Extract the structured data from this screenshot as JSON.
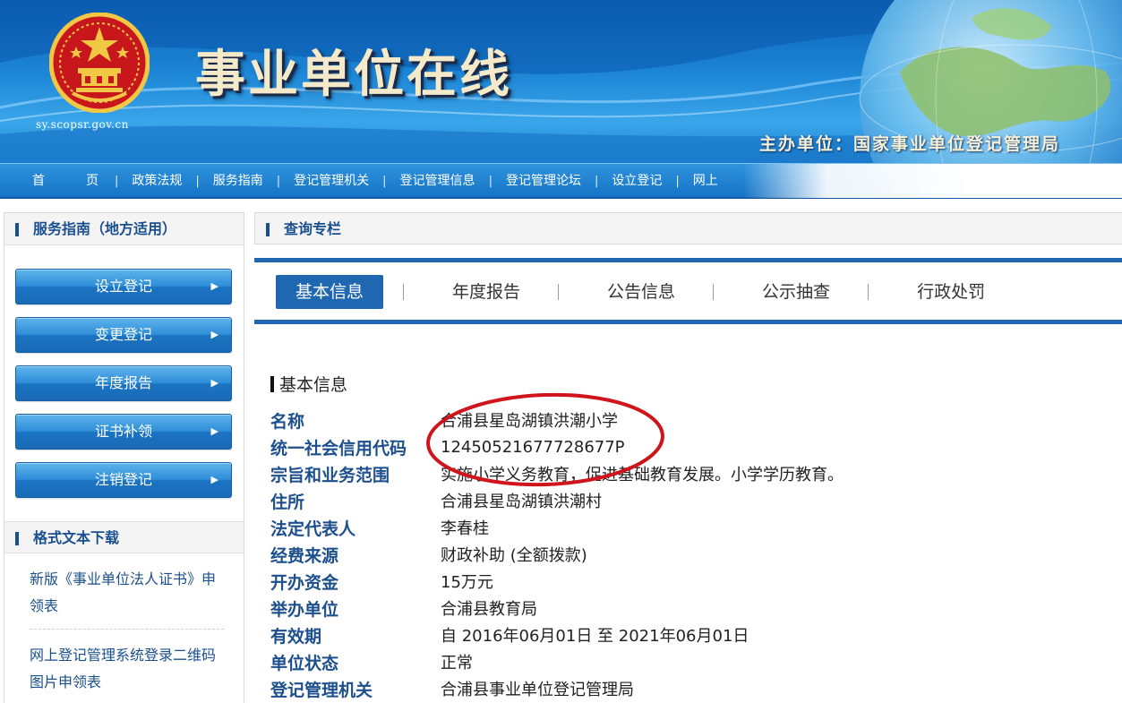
{
  "banner": {
    "title": "事业单位在线",
    "domain": "sy.scopsr.gov.cn",
    "host": "主办单位：国家事业单位登记管理局"
  },
  "nav": {
    "items": [
      "首　页",
      "政策法规",
      "服务指南",
      "登记管理机关",
      "登记管理信息",
      "登记管理论坛",
      "设立登记",
      "网上"
    ],
    "separator": "|"
  },
  "left": {
    "service_title": "服务指南（地方适用）",
    "buttons": [
      "设立登记",
      "变更登记",
      "年度报告",
      "证书补领",
      "注销登记"
    ],
    "download_title": "格式文本下载",
    "downloads": [
      "新版《事业单位法人证书》申领表",
      "网上登记管理系统登录二维码图片申领表"
    ]
  },
  "right": {
    "query_title": "查询专栏",
    "tabs": [
      "基本信息",
      "年度报告",
      "公告信息",
      "公示抽查",
      "行政处罚"
    ],
    "info_title": "基本信息",
    "fields": [
      {
        "label": "名称",
        "value": "合浦县星岛湖镇洪潮小学"
      },
      {
        "label": "统一社会信用代码",
        "value": "12450521677728677P"
      },
      {
        "label": "宗旨和业务范围",
        "value": "实施小学义务教育，促进基础教育发展。小学学历教育。"
      },
      {
        "label": "住所",
        "value": "合浦县星岛湖镇洪潮村"
      },
      {
        "label": "法定代表人",
        "value": "李春桂"
      },
      {
        "label": "经费来源",
        "value": "财政补助 (全额拨款)"
      },
      {
        "label": "开办资金",
        "value": "15万元"
      },
      {
        "label": "举办单位",
        "value": "合浦县教育局"
      },
      {
        "label": "有效期",
        "value": "自 2016年06月01日 至 2021年06月01日"
      },
      {
        "label": "单位状态",
        "value": "正常"
      },
      {
        "label": "登记管理机关",
        "value": "合浦县事业单位登记管理局"
      }
    ]
  },
  "colors": {
    "brand_blue": "#1f67b1",
    "label_blue": "#1d4f8d",
    "annotation_red": "#d0141c"
  },
  "icons": [
    "national-emblem",
    "globe-graphic",
    "chevron-right-icon"
  ]
}
